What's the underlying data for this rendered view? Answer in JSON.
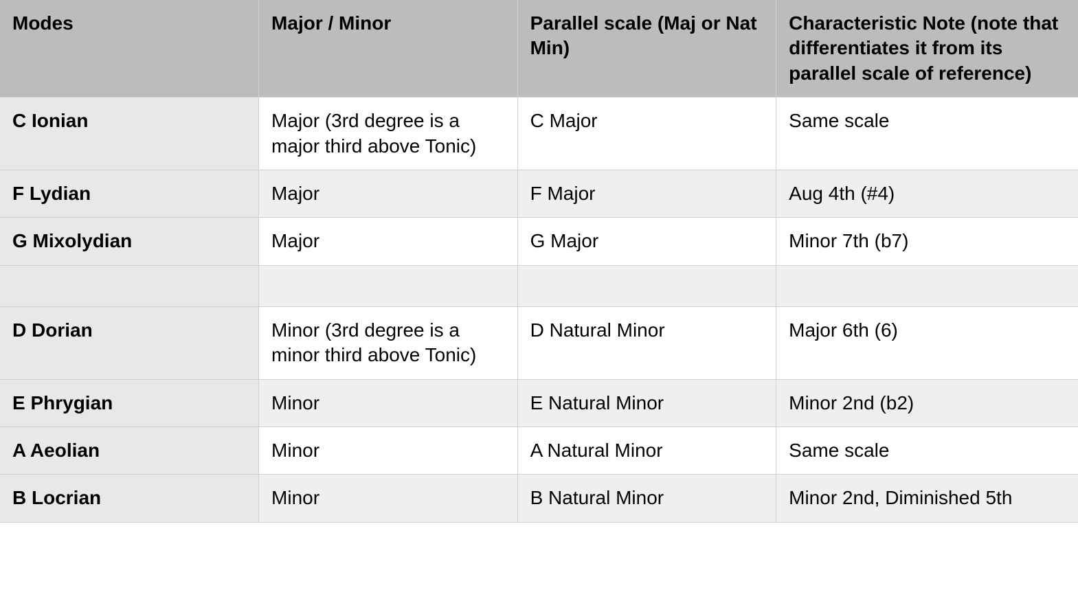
{
  "headers": {
    "modes": "Modes",
    "major_minor": "Major / Minor",
    "parallel": "Parallel scale (Maj or Nat Min)",
    "characteristic": "Characteristic Note (note that differentiates it from its parallel scale of reference)"
  },
  "rows": [
    {
      "mode": "C Ionian",
      "quality": "Major (3rd degree is a major third above Tonic)",
      "parallel": "C Major",
      "characteristic": "Same scale"
    },
    {
      "mode": "F Lydian",
      "quality": "Major",
      "parallel": "F Major",
      "characteristic": "Aug 4th (#4)"
    },
    {
      "mode": "G Mixolydian",
      "quality": "Major",
      "parallel": "G Major",
      "characteristic": "Minor 7th (b7)"
    },
    {
      "mode": "",
      "quality": "",
      "parallel": "",
      "characteristic": ""
    },
    {
      "mode": "D Dorian",
      "quality": "Minor (3rd degree is a minor third above Tonic)",
      "parallel": "D Natural Minor",
      "characteristic": "Major 6th (6)"
    },
    {
      "mode": "E Phrygian",
      "quality": "Minor",
      "parallel": "E Natural Minor",
      "characteristic": "Minor 2nd (b2)"
    },
    {
      "mode": "A Aeolian",
      "quality": "Minor",
      "parallel": "A Natural Minor",
      "characteristic": "Same scale"
    },
    {
      "mode": "B Locrian",
      "quality": "Minor",
      "parallel": "B Natural Minor",
      "characteristic": "Minor 2nd, Diminished 5th"
    }
  ]
}
